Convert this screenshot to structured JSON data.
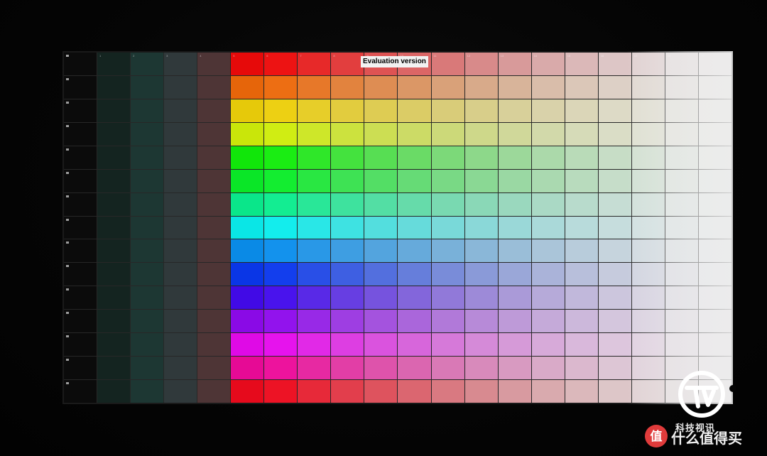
{
  "image": {
    "subject": "projected color test pattern"
  },
  "test_pattern": {
    "label": "Evaluation version",
    "columns": 20,
    "rows": 15,
    "column_numbers": [
      "0",
      "1",
      "2",
      "3",
      "4",
      "5",
      "6",
      "7",
      "8",
      "9",
      "10",
      "11",
      "12",
      "13",
      "14",
      "15",
      "16",
      "17",
      "18",
      "19"
    ],
    "row_hues": [
      0,
      25,
      52,
      68,
      118,
      128,
      155,
      180,
      205,
      228,
      255,
      275,
      298,
      322,
      355
    ],
    "gray_columns": [
      "#0b0b0b",
      "#142420",
      "#1d3733",
      "#30393b",
      "#4e3536"
    ]
  },
  "watermark": {
    "caption": "科技视讯",
    "brand": "什么值得买",
    "badge_glyph": "值",
    "logo_colors": {
      "ring": "#ffffff",
      "accent": "#e03b3b"
    }
  }
}
